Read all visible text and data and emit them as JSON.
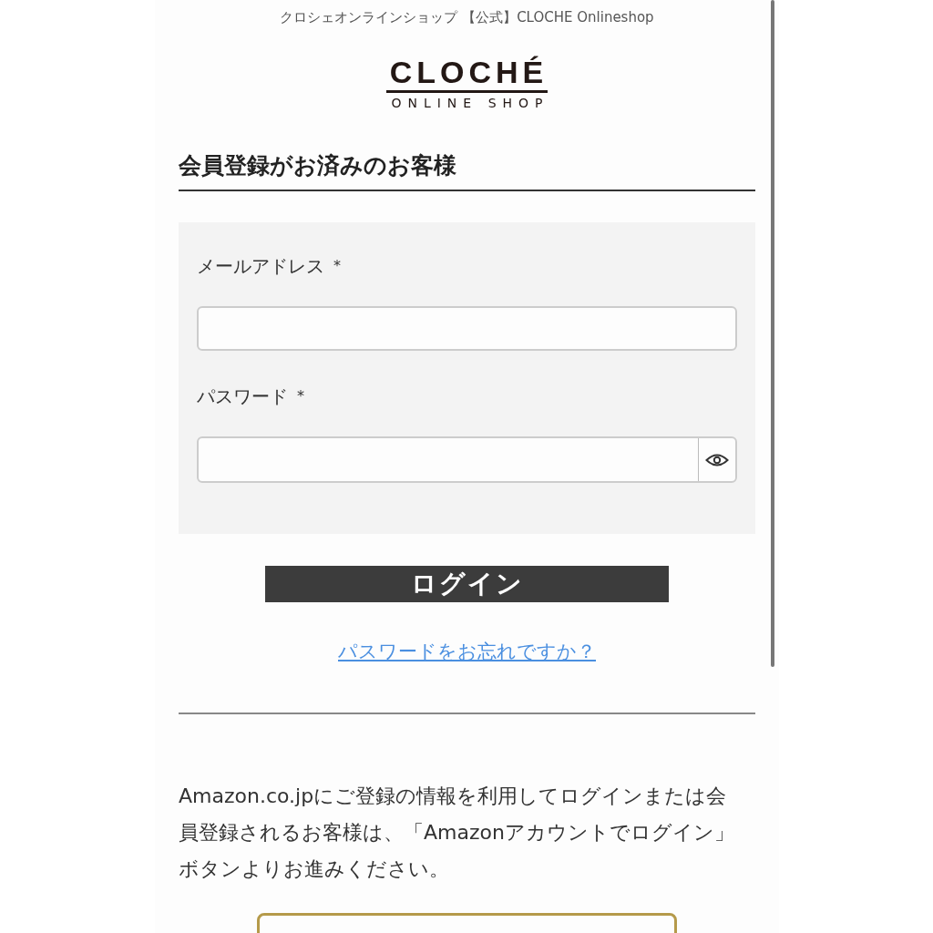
{
  "header": {
    "site_title": "クロシェオンラインショップ 【公式】CLOCHE Onlineshop"
  },
  "logo": {
    "brand": "CLOCHÉ",
    "tagline": "ONLINE SHOP"
  },
  "section": {
    "heading": "会員登録がお済みのお客様"
  },
  "form": {
    "fields": [
      {
        "label": "メールアドレス",
        "required_mark": "*",
        "kind": "text"
      },
      {
        "label": "パスワード",
        "required_mark": "*",
        "kind": "password"
      }
    ]
  },
  "login_button": "ログイン",
  "forgot_link": "パスワードをお忘れですか？",
  "amazon_note": "Amazon.co.jpにご登録の情報を利用してログインまたは会員登録されるお客様は、「Amazonアカウントでログイン」ボタンよりお進みください。"
}
